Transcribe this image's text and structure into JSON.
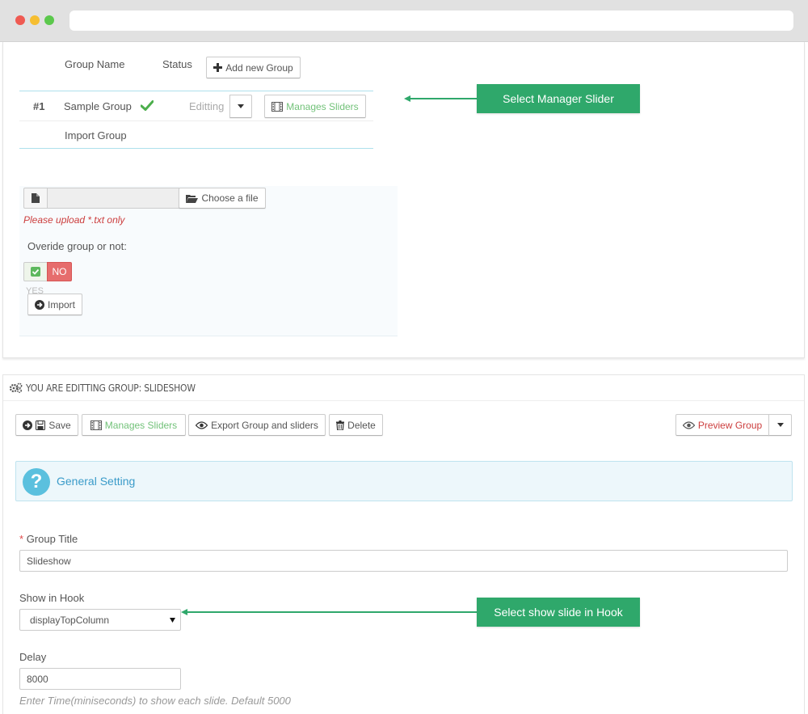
{
  "panel_top": {
    "headers": {
      "group_name": "Group Name",
      "status": "Status",
      "add_new_group": "Add new Group"
    },
    "row": {
      "index": "#1",
      "name": "Sample Group",
      "status_select": "Editting",
      "manages_sliders": "Manages Sliders"
    },
    "import_group": "Import Group",
    "upload": {
      "choose_file": "Choose a file",
      "warning": "Please upload *.txt only",
      "override_label": "Overide group or not:",
      "toggle_no": "NO",
      "toggle_yes": "YES",
      "import_button": "Import"
    }
  },
  "callouts": {
    "manager_slider": "Select Manager Slider",
    "show_in_hook": "Select show slide in Hook"
  },
  "panel_edit": {
    "title": "YOU ARE EDITTING GROUP: SLIDESHOW",
    "toolbar": {
      "save": "Save",
      "manages_sliders": "Manages Sliders",
      "export": "Export Group and sliders",
      "delete": "Delete",
      "preview": "Preview Group"
    },
    "general_setting": "General Setting",
    "group_title": {
      "required_mark": "*",
      "label": "Group Title",
      "value": "Slideshow"
    },
    "show_in_hook": {
      "label": "Show in Hook",
      "value": "displayTopColumn"
    },
    "delay": {
      "label": "Delay",
      "value": "8000",
      "hint": "Enter Time(miniseconds) to show each slide. Default 5000"
    }
  },
  "colors": {
    "accent_green": "#2fa86b",
    "danger": "#e66d6d",
    "info": "#5bc0de"
  }
}
